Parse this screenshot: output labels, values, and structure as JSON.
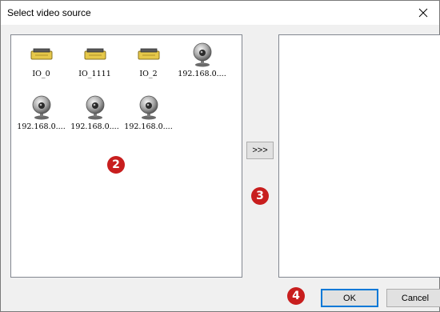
{
  "window": {
    "title": "Select video source",
    "close_glyph": "✕",
    "close_icon": "close-icon"
  },
  "sources": [
    {
      "label": "IO_0",
      "icon": "io-device-icon"
    },
    {
      "label": "IO_1111",
      "icon": "io-device-icon"
    },
    {
      "label": "IO_2",
      "icon": "io-device-icon"
    },
    {
      "label": "192.168.0....",
      "icon": "webcam-icon"
    },
    {
      "label": "192.168.0....",
      "icon": "webcam-icon"
    },
    {
      "label": "192.168.0....",
      "icon": "webcam-icon"
    },
    {
      "label": "192.168.0....",
      "icon": "webcam-icon"
    }
  ],
  "buttons": {
    "move_label": ">>>",
    "ok_label": "OK",
    "cancel_label": "Cancel"
  },
  "markers": {
    "m2": "2",
    "m3": "3",
    "m4": "4"
  },
  "colors": {
    "marker": "#c81e1e",
    "io_icon": "#e6c84a",
    "default_button_border": "#0078d7"
  }
}
